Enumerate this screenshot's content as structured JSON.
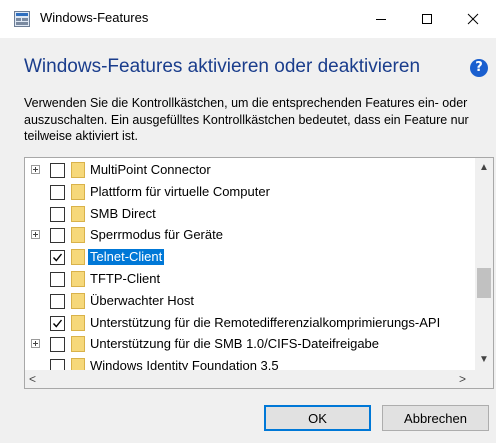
{
  "window": {
    "title": "Windows-Features",
    "heading": "Windows-Features aktivieren oder deaktivieren",
    "description": "Verwenden Sie die Kontrollkästchen, um die entsprechenden Features ein- oder auszuschalten. Ein ausgefülltes Kontrollkästchen bedeutet, dass ein Feature nur teilweise aktiviert ist."
  },
  "titlebar_buttons": {
    "minimize": "—",
    "maximize": "☐",
    "close": "✕"
  },
  "help": {
    "glyph": "?"
  },
  "features": [
    {
      "label": "MultiPoint Connector",
      "checked": false,
      "expandable": true,
      "selected": false
    },
    {
      "label": "Plattform für virtuelle Computer",
      "checked": false,
      "expandable": false,
      "selected": false
    },
    {
      "label": "SMB Direct",
      "checked": false,
      "expandable": false,
      "selected": false
    },
    {
      "label": "Sperrmodus für Geräte",
      "checked": false,
      "expandable": true,
      "selected": false
    },
    {
      "label": "Telnet-Client",
      "checked": true,
      "expandable": false,
      "selected": true
    },
    {
      "label": "TFTP-Client",
      "checked": false,
      "expandable": false,
      "selected": false
    },
    {
      "label": "Überwachter Host",
      "checked": false,
      "expandable": false,
      "selected": false
    },
    {
      "label": "Unterstützung für die Remotedifferenzialkomprimierungs-API",
      "checked": true,
      "expandable": false,
      "selected": false
    },
    {
      "label": "Unterstützung für die SMB 1.0/CIFS-Dateifreigabe",
      "checked": false,
      "expandable": true,
      "selected": false
    },
    {
      "label": "Windows Identity Foundation 3.5",
      "checked": false,
      "expandable": false,
      "selected": false
    }
  ],
  "buttons": {
    "ok": "OK",
    "cancel": "Abbrechen"
  },
  "colors": {
    "heading": "#1a3d8c",
    "selection": "#0078d7",
    "folder": "#f6d87a"
  }
}
